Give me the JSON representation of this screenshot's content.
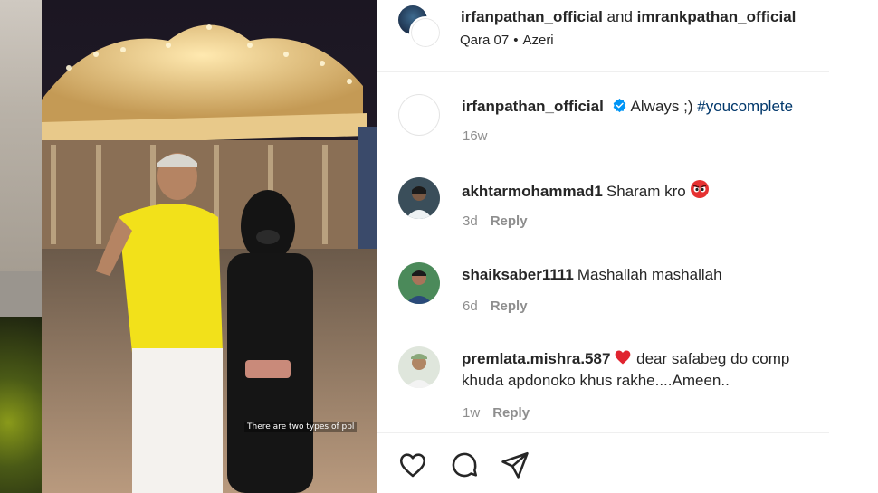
{
  "header": {
    "user1": "irfanpathan_official",
    "joiner": "and",
    "user2": "imrankpathan_official",
    "date": "Qara 07",
    "dot": "•",
    "language": "Azeri"
  },
  "media": {
    "overlay_text": "There are two types of ppl"
  },
  "caption": {
    "username": "irfanpathan_official",
    "text": "Always ;) ",
    "hashtag": "#youcomplete",
    "time": "16w"
  },
  "comments": [
    {
      "username": "akhtarmohammad1",
      "text": "Sharam kro ",
      "emoji": "angry-face-emoji",
      "time": "3d",
      "reply": "Reply"
    },
    {
      "username": "shaiksaber1111",
      "text": "Mashallah mashallah",
      "time": "6d",
      "reply": "Reply"
    },
    {
      "username": "premlata.mishra.587",
      "emoji": "red-heart-emoji",
      "text": " dear safabeg do comp",
      "text2": "khuda apdonoko khus rakhe....Ameen..",
      "time": "1w",
      "reply": "Reply"
    }
  ],
  "actions": {
    "icons": [
      "heart-icon",
      "comment-icon",
      "share-icon"
    ]
  },
  "colors": {
    "text": "#262626",
    "muted": "#8e8e8e",
    "hashtag": "#00376b",
    "verified": "#0095f6",
    "heart": "#ed4956",
    "divider": "#efefef"
  }
}
